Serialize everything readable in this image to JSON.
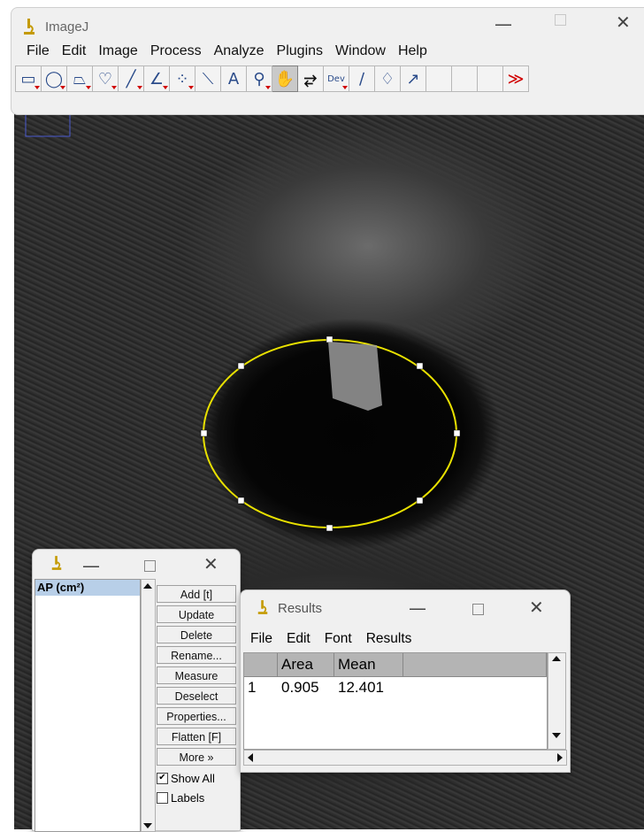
{
  "imagej": {
    "title": "ImageJ",
    "menu": [
      "File",
      "Edit",
      "Image",
      "Process",
      "Analyze",
      "Plugins",
      "Window",
      "Help"
    ],
    "tools": [
      {
        "icon": "rectangle-tool-icon",
        "glyph": "▭"
      },
      {
        "icon": "oval-tool-icon",
        "glyph": "◯"
      },
      {
        "icon": "polygon-tool-icon",
        "glyph": "⏢"
      },
      {
        "icon": "freehand-tool-icon",
        "glyph": "♡"
      },
      {
        "icon": "line-tool-icon",
        "glyph": "╱"
      },
      {
        "icon": "angle-tool-icon",
        "glyph": "∠"
      },
      {
        "icon": "multipoint-tool-icon",
        "glyph": "⁘"
      },
      {
        "icon": "wand-tool-icon",
        "glyph": "⟍"
      },
      {
        "icon": "text-tool-icon",
        "glyph": "A"
      },
      {
        "icon": "magnifier-tool-icon",
        "glyph": "⚲"
      },
      {
        "icon": "hand-tool-icon",
        "glyph": "✋"
      },
      {
        "icon": "dropper-tool-icon",
        "glyph": "⥂"
      },
      {
        "icon": "dev-tool-icon",
        "glyph": "Dev"
      },
      {
        "icon": "brush-tool-icon",
        "glyph": "∕"
      },
      {
        "icon": "flood-fill-tool-icon",
        "glyph": "♢"
      },
      {
        "icon": "arrow-tool-icon",
        "glyph": "↗"
      },
      {
        "icon": "empty-slot",
        "glyph": ""
      },
      {
        "icon": "empty-slot",
        "glyph": ""
      },
      {
        "icon": "empty-slot",
        "glyph": ""
      },
      {
        "icon": "more-tools-icon",
        "glyph": "≫"
      }
    ],
    "active_tool_index": 10,
    "accent": "#2a4b8a",
    "menu_arrow_color": "#d00000"
  },
  "roi_manager": {
    "list_header": "AP (cm²)",
    "buttons": [
      "Add [t]",
      "Update",
      "Delete",
      "Rename...",
      "Measure",
      "Deselect",
      "Properties...",
      "Flatten [F]",
      "More »"
    ],
    "show_all_label": "Show All",
    "show_all_checked": true,
    "labels_label": "Labels",
    "labels_checked": false
  },
  "results": {
    "title": "Results",
    "menu": [
      "File",
      "Edit",
      "Font",
      "Results"
    ],
    "columns": [
      "",
      "Area",
      "Mean",
      ""
    ],
    "rows": [
      [
        "1",
        "0.905",
        "12.401",
        ""
      ]
    ]
  },
  "roi_color": "#e8e000"
}
